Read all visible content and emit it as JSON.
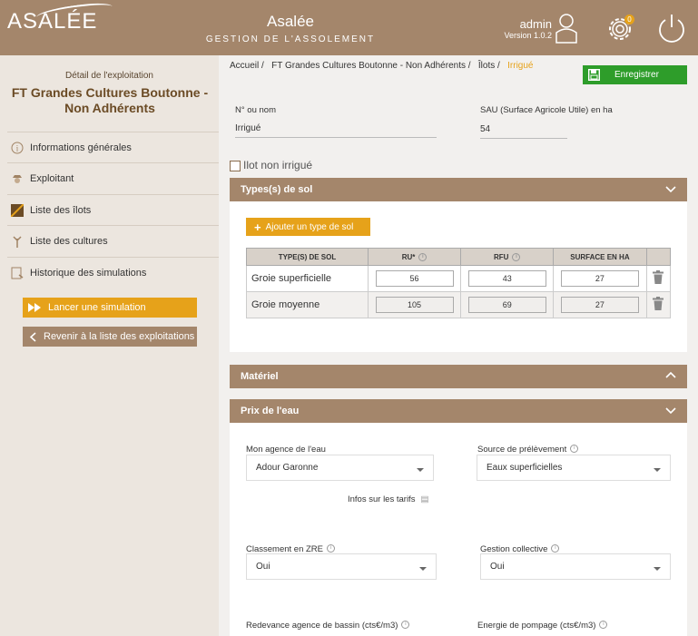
{
  "header": {
    "logo": "ASALÉE",
    "title": "Asalée",
    "subtitle": "GESTION DE L'ASSOLEMENT",
    "user": "admin",
    "version": "Version 1.0.2",
    "notifications": "0"
  },
  "sidebar": {
    "caption": "Détail de l'exploitation",
    "title": "FT Grandes Cultures Boutonne - Non Adhérents",
    "items": [
      {
        "label": "Informations générales",
        "icon": "info-icon"
      },
      {
        "label": "Exploitant",
        "icon": "farmer-icon"
      },
      {
        "label": "Liste des îlots",
        "icon": "parcel-icon"
      },
      {
        "label": "Liste des cultures",
        "icon": "crop-icon"
      },
      {
        "label": "Historique des simulations",
        "icon": "history-icon"
      }
    ],
    "run_simulation": "Lancer une simulation",
    "back_to_list": "Revenir à la liste des exploitations"
  },
  "breadcrumb": [
    "Accueil",
    "FT Grandes Cultures Boutonne - Non Adhérents",
    "Îlots",
    "Irrigué"
  ],
  "save_label": "Enregistrer",
  "form": {
    "name_label": "N° ou nom",
    "name_value": "Irrigué",
    "sau_label": "SAU (Surface Agricole Utile) en ha",
    "sau_value": "54",
    "non_irrigated_label": "Ilot non irrigué"
  },
  "soil_section": {
    "title": "Types(s) de sol",
    "add_button": "Ajouter un type de sol",
    "columns": [
      "TYPE(S) DE SOL",
      "RU*",
      "RFU",
      "SURFACE EN HA"
    ],
    "rows": [
      {
        "type": "Groie superficielle",
        "ru": "56",
        "rfu": "43",
        "surface": "27"
      },
      {
        "type": "Groie moyenne",
        "ru": "105",
        "rfu": "69",
        "surface": "27"
      }
    ]
  },
  "material_section": {
    "title": "Matériel"
  },
  "water_section": {
    "title": "Prix de l'eau",
    "agency_label": "Mon agence de l'eau",
    "agency_value": "Adour Garonne",
    "source_label": "Source de prélèvement",
    "source_value": "Eaux superficielles",
    "tariffs_link": "Infos sur les tarifs",
    "zre_label": "Classement en ZRE",
    "zre_value": "Oui",
    "collective_label": "Gestion collective",
    "collective_value": "Oui",
    "fee_label": "Redevance agence de bassin (cts€/m3)",
    "energy_label": "Energie de pompage (cts€/m3)"
  },
  "colors": {
    "brand": "#a4866b",
    "accent": "#e6a21a",
    "save": "#2e9d2a"
  }
}
